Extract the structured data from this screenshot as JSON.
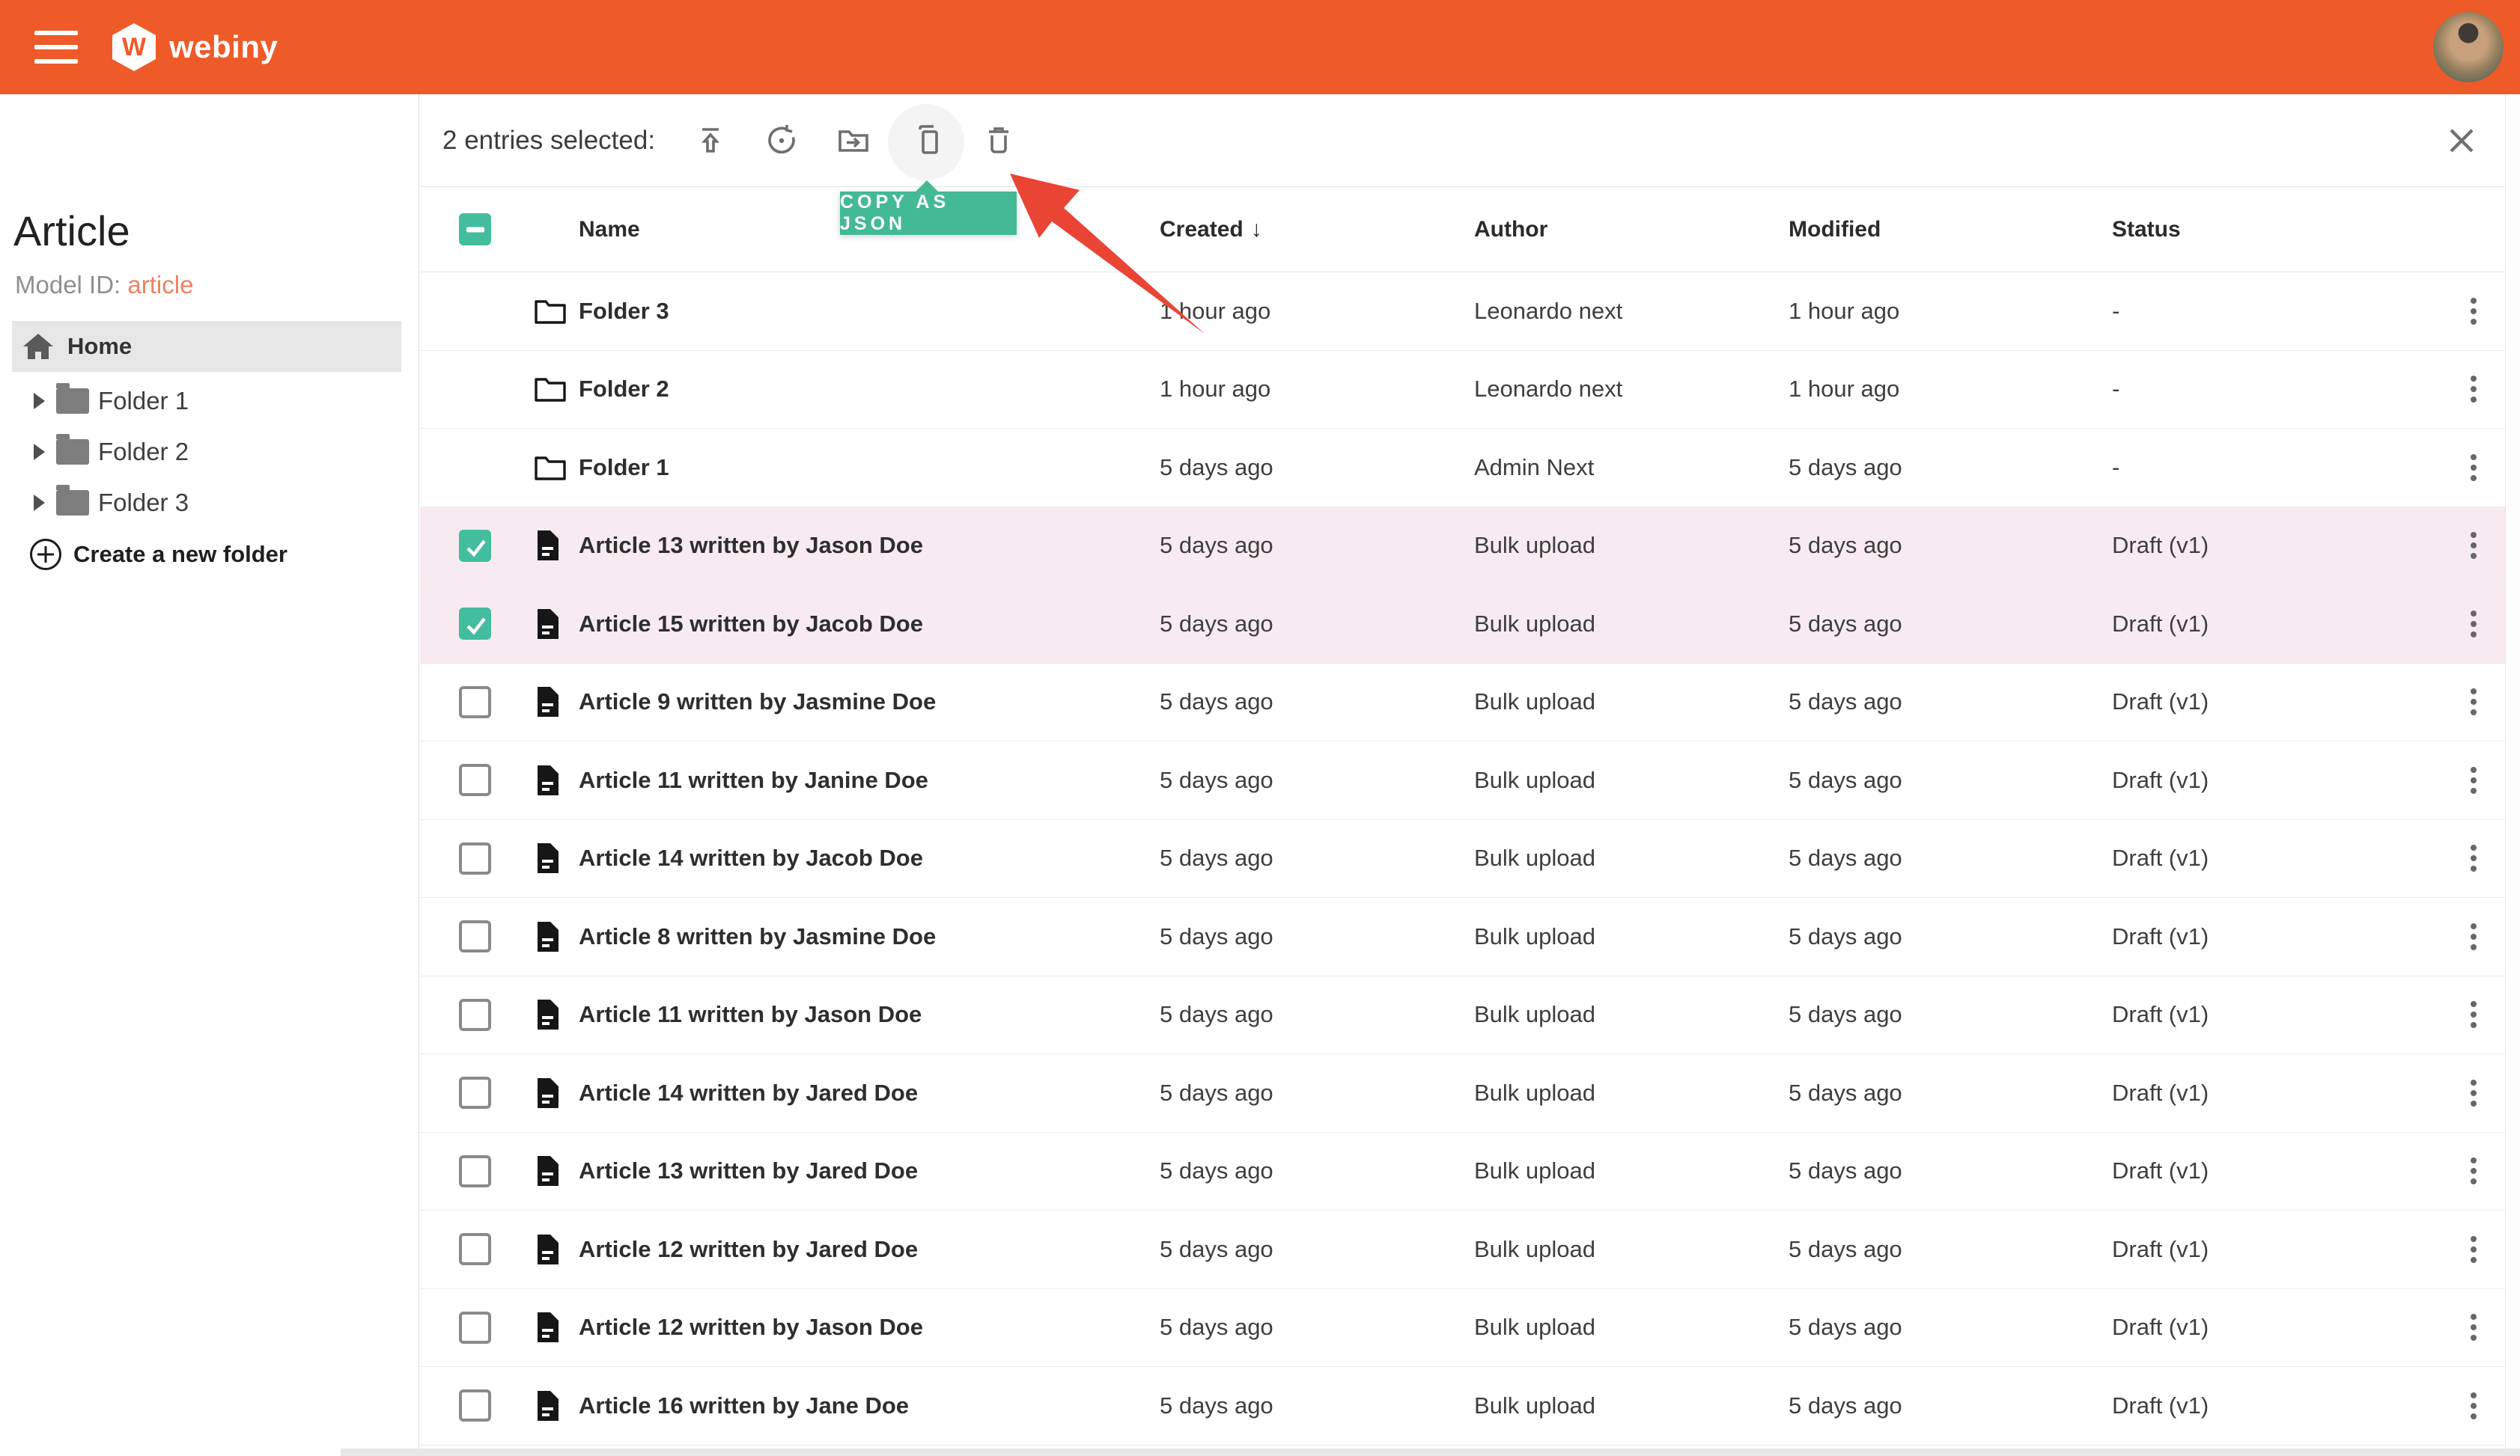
{
  "topbar": {
    "brand_text": "webiny",
    "brand_letter": "W"
  },
  "sidebar": {
    "title": "Article",
    "model_id_label": "Model ID:",
    "model_id_value": "article",
    "home_label": "Home",
    "folders": [
      {
        "label": "Folder 1"
      },
      {
        "label": "Folder 2"
      },
      {
        "label": "Folder 3"
      }
    ],
    "create_folder_label": "Create a new folder"
  },
  "toolbar": {
    "selection_text": "2 entries selected:",
    "actions": [
      "publish-icon",
      "restore-revision-icon",
      "move-to-folder-icon",
      "copy-icon",
      "delete-icon"
    ],
    "active_action": "copy",
    "tooltip": "COPY AS JSON"
  },
  "table": {
    "columns": [
      "Name",
      "Created",
      "Author",
      "Modified",
      "Status"
    ],
    "sort": {
      "column": "Created",
      "direction": "desc",
      "arrow": "↓"
    },
    "rows": [
      {
        "type": "folder",
        "selected": false,
        "name": "Folder 3",
        "created": "1 hour ago",
        "author": "Leonardo next",
        "modified": "1 hour ago",
        "status": "-"
      },
      {
        "type": "folder",
        "selected": false,
        "name": "Folder 2",
        "created": "1 hour ago",
        "author": "Leonardo next",
        "modified": "1 hour ago",
        "status": "-"
      },
      {
        "type": "folder",
        "selected": false,
        "name": "Folder 1",
        "created": "5 days ago",
        "author": "Admin Next",
        "modified": "5 days ago",
        "status": "-"
      },
      {
        "type": "article",
        "selected": true,
        "name": "Article 13 written by Jason Doe",
        "created": "5 days ago",
        "author": "Bulk upload",
        "modified": "5 days ago",
        "status": "Draft (v1)"
      },
      {
        "type": "article",
        "selected": true,
        "name": "Article 15 written by Jacob Doe",
        "created": "5 days ago",
        "author": "Bulk upload",
        "modified": "5 days ago",
        "status": "Draft (v1)"
      },
      {
        "type": "article",
        "selected": false,
        "name": "Article 9 written by Jasmine Doe",
        "created": "5 days ago",
        "author": "Bulk upload",
        "modified": "5 days ago",
        "status": "Draft (v1)"
      },
      {
        "type": "article",
        "selected": false,
        "name": "Article 11 written by Janine Doe",
        "created": "5 days ago",
        "author": "Bulk upload",
        "modified": "5 days ago",
        "status": "Draft (v1)"
      },
      {
        "type": "article",
        "selected": false,
        "name": "Article 14 written by Jacob Doe",
        "created": "5 days ago",
        "author": "Bulk upload",
        "modified": "5 days ago",
        "status": "Draft (v1)"
      },
      {
        "type": "article",
        "selected": false,
        "name": "Article 8 written by Jasmine Doe",
        "created": "5 days ago",
        "author": "Bulk upload",
        "modified": "5 days ago",
        "status": "Draft (v1)"
      },
      {
        "type": "article",
        "selected": false,
        "name": "Article 11 written by Jason Doe",
        "created": "5 days ago",
        "author": "Bulk upload",
        "modified": "5 days ago",
        "status": "Draft (v1)"
      },
      {
        "type": "article",
        "selected": false,
        "name": "Article 14 written by Jared Doe",
        "created": "5 days ago",
        "author": "Bulk upload",
        "modified": "5 days ago",
        "status": "Draft (v1)"
      },
      {
        "type": "article",
        "selected": false,
        "name": "Article 13 written by Jared Doe",
        "created": "5 days ago",
        "author": "Bulk upload",
        "modified": "5 days ago",
        "status": "Draft (v1)"
      },
      {
        "type": "article",
        "selected": false,
        "name": "Article 12 written by Jared Doe",
        "created": "5 days ago",
        "author": "Bulk upload",
        "modified": "5 days ago",
        "status": "Draft (v1)"
      },
      {
        "type": "article",
        "selected": false,
        "name": "Article 12 written by Jason Doe",
        "created": "5 days ago",
        "author": "Bulk upload",
        "modified": "5 days ago",
        "status": "Draft (v1)"
      },
      {
        "type": "article",
        "selected": false,
        "name": "Article 16 written by Jane Doe",
        "created": "5 days ago",
        "author": "Bulk upload",
        "modified": "5 days ago",
        "status": "Draft (v1)"
      }
    ]
  },
  "colors": {
    "topbar_orange": "#ef5a29",
    "model_id_accent": "#ec8261",
    "teal_accent": "#43bd9d",
    "tooltip_teal": "#43b995",
    "selected_row_pink": "#f7ebf1",
    "annotation_red": "#ea4435"
  }
}
